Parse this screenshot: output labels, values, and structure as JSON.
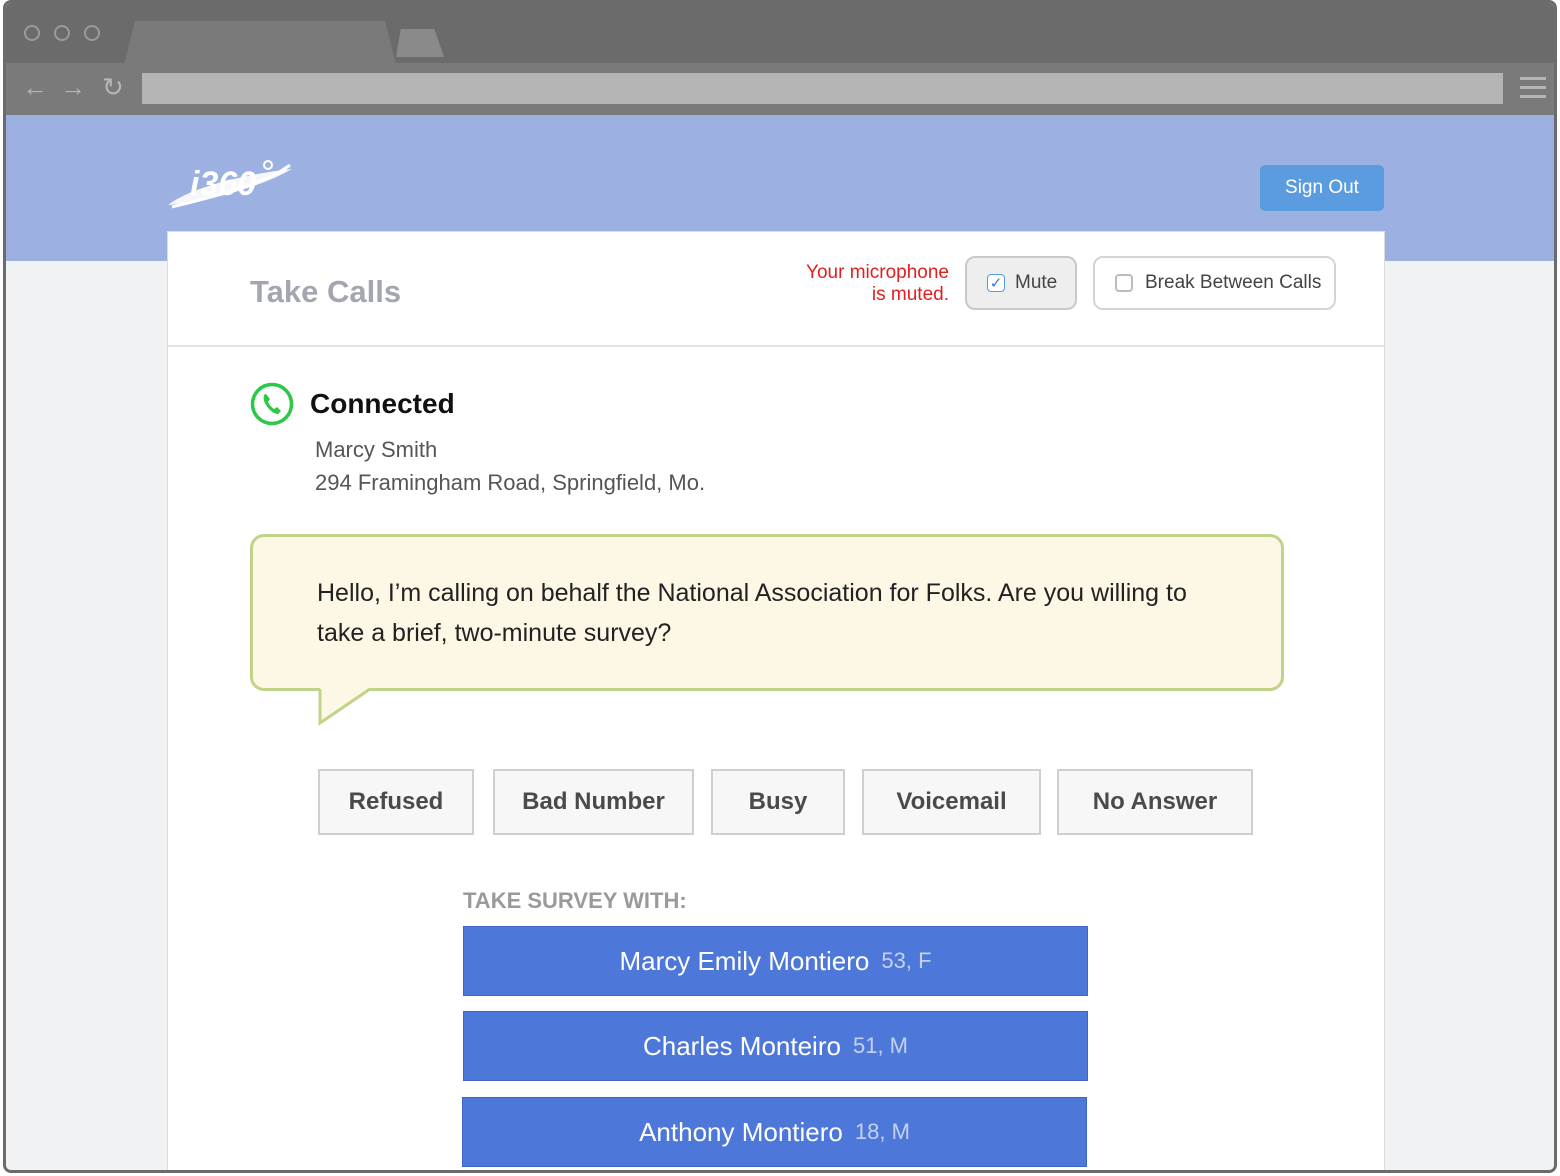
{
  "app": {
    "logo_text": "i360°"
  },
  "header": {
    "sign_out_label": "Sign Out"
  },
  "card": {
    "title": "Take Calls",
    "mute_warning_line1": "Your microphone",
    "mute_warning_line2": "is muted.",
    "mute": {
      "label": "Mute",
      "checked": true
    },
    "break": {
      "label": "Break Between Calls",
      "checked": false
    }
  },
  "call": {
    "status": "Connected",
    "contact_name": "Marcy Smith",
    "contact_address": "294 Framingham Road, Springfield, Mo.",
    "script": "Hello, I’m calling on behalf the National Association for Folks. Are you willing to take a brief, two-minute survey?"
  },
  "dispositions": [
    {
      "label": "Refused"
    },
    {
      "label": "Bad Number"
    },
    {
      "label": "Busy"
    },
    {
      "label": "Voicemail"
    },
    {
      "label": "No Answer"
    }
  ],
  "survey": {
    "label": "TAKE SURVEY WITH:",
    "people": [
      {
        "name": "Marcy Emily Montiero",
        "meta": "53, F"
      },
      {
        "name": "Charles Monteiro",
        "meta": "51, M"
      },
      {
        "name": "Anthony Montiero",
        "meta": "18, M"
      }
    ]
  },
  "colors": {
    "header_band": "#9db0e2",
    "accent_blue": "#4d77d8",
    "sign_out": "#5b9be0",
    "warning_red": "#e02020",
    "connected_green": "#2cc84a",
    "bubble_bg": "#fdf8e6",
    "bubble_border": "#c0d388"
  },
  "icons": {
    "status": "phone-icon",
    "nav": [
      "back-arrow-icon",
      "forward-arrow-icon",
      "reload-icon",
      "menu-icon"
    ]
  }
}
